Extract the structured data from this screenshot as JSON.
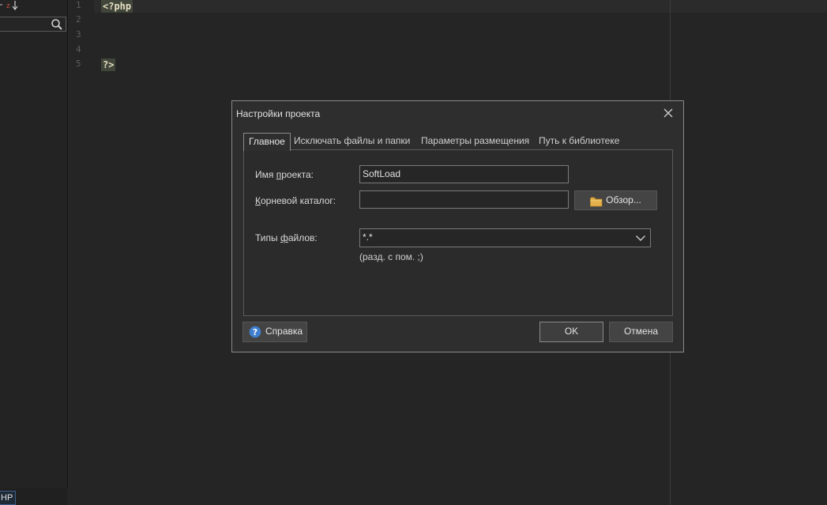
{
  "sidebar": {
    "sort_icon": "sort-az-icon",
    "search_icon": "search-icon",
    "language_badge": "HP"
  },
  "editor": {
    "line_numbers": [
      "1",
      "2",
      "3",
      "4",
      "5"
    ],
    "open_tag": "<?php",
    "close_tag": "?>"
  },
  "dialog": {
    "title": "Настройки проекта",
    "close_icon": "close-icon",
    "tabs": [
      {
        "label": "Главное",
        "active": true
      },
      {
        "label": "Исключать файлы и папки",
        "active": false
      },
      {
        "label": "Параметры размещения",
        "active": false
      },
      {
        "label": "Путь к библиотеке",
        "active": false
      }
    ],
    "project_name_label_pre": "Имя ",
    "project_name_label_u": "п",
    "project_name_label_post": "роекта:",
    "project_name_value": "SoftLoad",
    "root_dir_label_u": "К",
    "root_dir_label_post": "орневой каталог:",
    "root_dir_value": "",
    "browse_label": "Обзор...",
    "file_types_label_pre": "Типы ",
    "file_types_label_u": "ф",
    "file_types_label_post": "айлов:",
    "file_types_value": "*.*",
    "file_types_hint": "(разд. с пом. ;)",
    "help_label": "Справка",
    "ok_label": "OK",
    "cancel_label": "Отмена"
  },
  "colors": {
    "background": "#252525",
    "dialog_bg": "#2e2e2e",
    "php_tag_bg": "#41463a",
    "folder": "#e3b04b",
    "help": "#3f7fcf"
  }
}
